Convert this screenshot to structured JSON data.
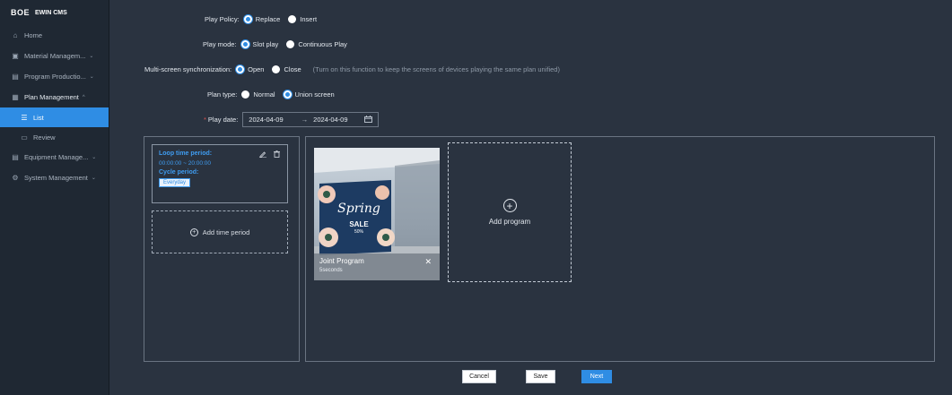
{
  "brand": {
    "logo": "BOE",
    "app": "EWIN CMS"
  },
  "sidebar": {
    "items": [
      {
        "label": "Home",
        "icon": "home-icon",
        "glyph": "⌂"
      },
      {
        "label": "Material Managem...",
        "icon": "image-icon",
        "glyph": "▣",
        "chevron": "⌄"
      },
      {
        "label": "Program Productio...",
        "icon": "program-icon",
        "glyph": "▤",
        "chevron": "⌄"
      },
      {
        "label": "Plan Management",
        "icon": "calendar-icon",
        "glyph": "▦",
        "chevron": "^"
      },
      {
        "label": "List",
        "icon": "list-icon",
        "glyph": "☰"
      },
      {
        "label": "Review",
        "icon": "review-icon",
        "glyph": "▭"
      },
      {
        "label": "Equipment Manage...",
        "icon": "equipment-icon",
        "glyph": "▤",
        "chevron": "⌄"
      },
      {
        "label": "System Management",
        "icon": "settings-icon",
        "glyph": "⚙",
        "chevron": "⌄"
      }
    ]
  },
  "form": {
    "play_policy": {
      "label": "Play Policy:",
      "options": [
        "Replace",
        "Insert"
      ],
      "selected": "Replace"
    },
    "play_mode": {
      "label": "Play mode:",
      "options": [
        "Slot play",
        "Continuous Play"
      ],
      "selected": "Slot play"
    },
    "sync": {
      "label": "Multi-screen synchronization:",
      "options": [
        "Open",
        "Close"
      ],
      "selected": "Open",
      "hint": "(Turn on this function to keep the screens of devices playing the same plan unified)"
    },
    "plan_type": {
      "label": "Plan type:",
      "options": [
        "Normal",
        "Union screen"
      ],
      "selected": "Union screen"
    },
    "play_date": {
      "required": "*",
      "label": "Play date:",
      "start": "2024-04-09",
      "sep": "→",
      "end": "2024-04-09",
      "cal_icon": "calendar-icon"
    }
  },
  "time_card": {
    "title": "Loop time period:",
    "range": "00:00:00 ~ 20:00:00",
    "cycle": "Cycle period:",
    "tag": "Everyday"
  },
  "add_period": {
    "label": "Add time period"
  },
  "program": {
    "name": "Joint Program",
    "duration": "5seconds",
    "thumb_text": {
      "line1": "Spring",
      "line2": "SALE",
      "line3": "50%"
    }
  },
  "add_program": {
    "label": "Add program"
  },
  "buttons": {
    "cancel": "Cancel",
    "save": "Save",
    "next": "Next"
  },
  "colors": {
    "accent": "#2f8de4",
    "sidebar": "#1f2833",
    "background": "#2a3340"
  }
}
